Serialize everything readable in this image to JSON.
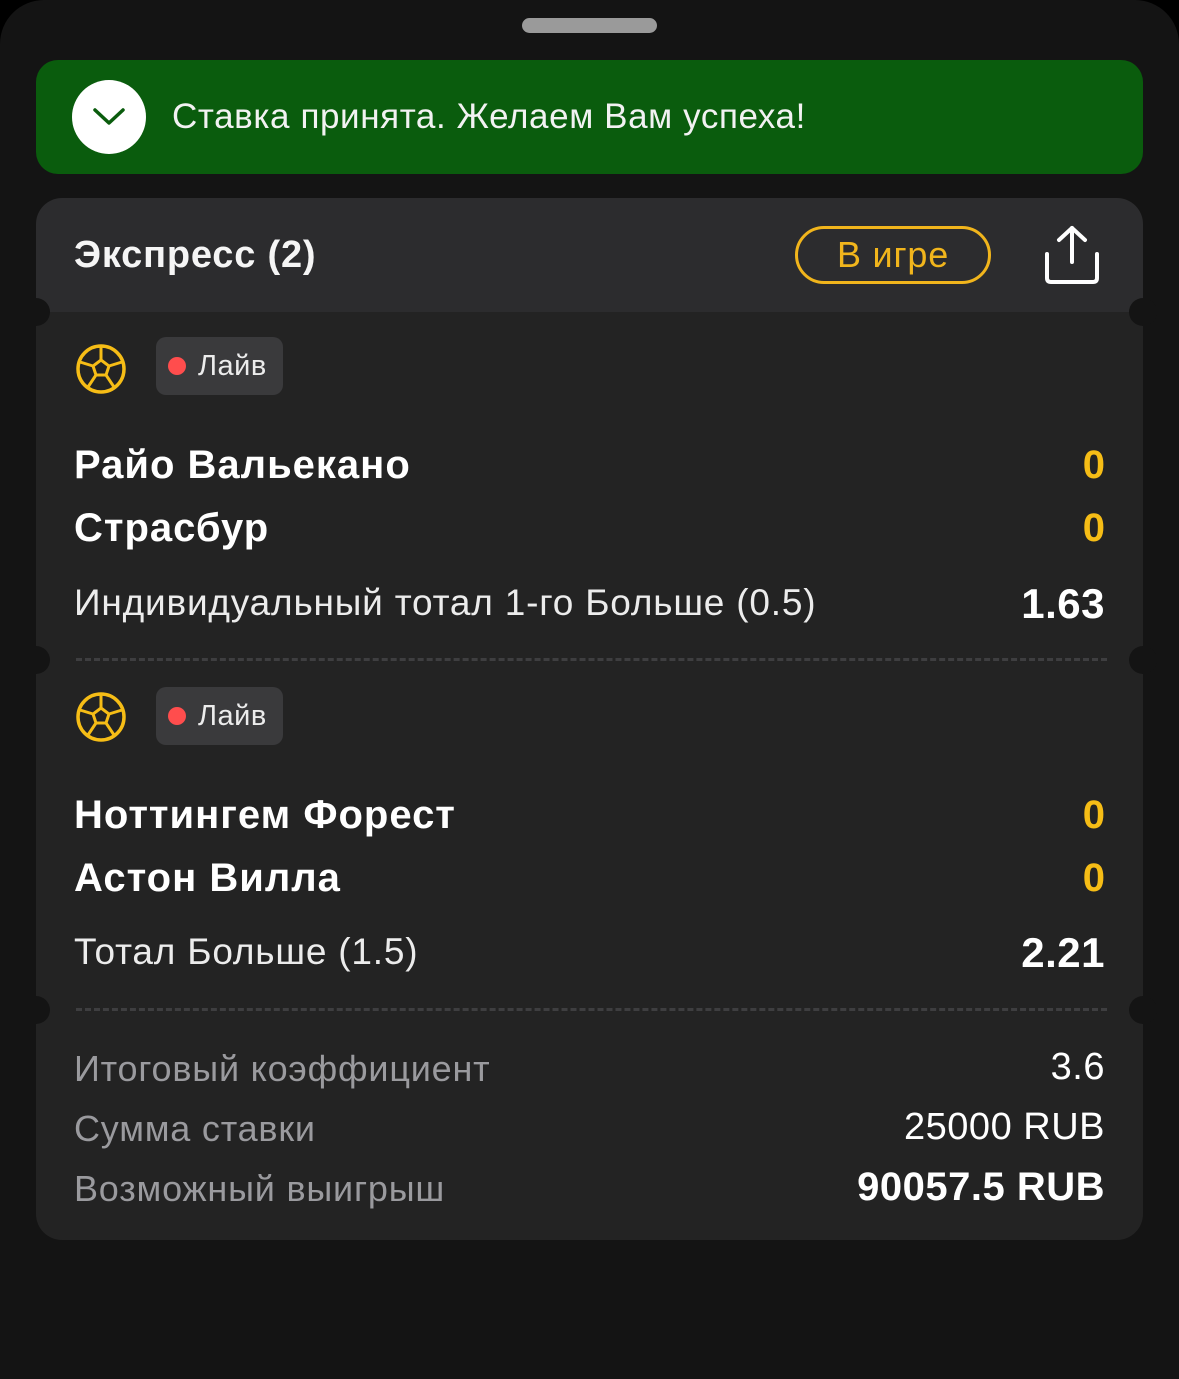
{
  "toast": {
    "icon": "chevron-down-icon",
    "text": "Ставка принята. Желаем Вам успеха!",
    "color": "#0a5c0d"
  },
  "bet": {
    "title": "Экспресс (2)",
    "status": "В игре",
    "status_color": "#f1b51c",
    "share_icon": "share-icon"
  },
  "events": [
    {
      "sport_icon": "football-icon",
      "live_label": "Лайв",
      "team1": "Райо Вальекано",
      "score1": "0",
      "team2": "Страсбур",
      "score2": "0",
      "market": "Индивидуальный тотал 1-го Больше (0.5)",
      "odds": "1.63"
    },
    {
      "sport_icon": "football-icon",
      "live_label": "Лайв",
      "team1": "Ноттингем Форест",
      "score1": "0",
      "team2": "Астон Вилла",
      "score2": "0",
      "market": "Тотал Больше (1.5)",
      "odds": "2.21"
    }
  ],
  "summary": {
    "total_odds_label": "Итоговый коэффициент",
    "total_odds_value": "3.6",
    "stake_label": "Сумма ставки",
    "stake_value": "25000 RUB",
    "payout_label": "Возможный выигрыш",
    "payout_value": "90057.5 RUB"
  }
}
